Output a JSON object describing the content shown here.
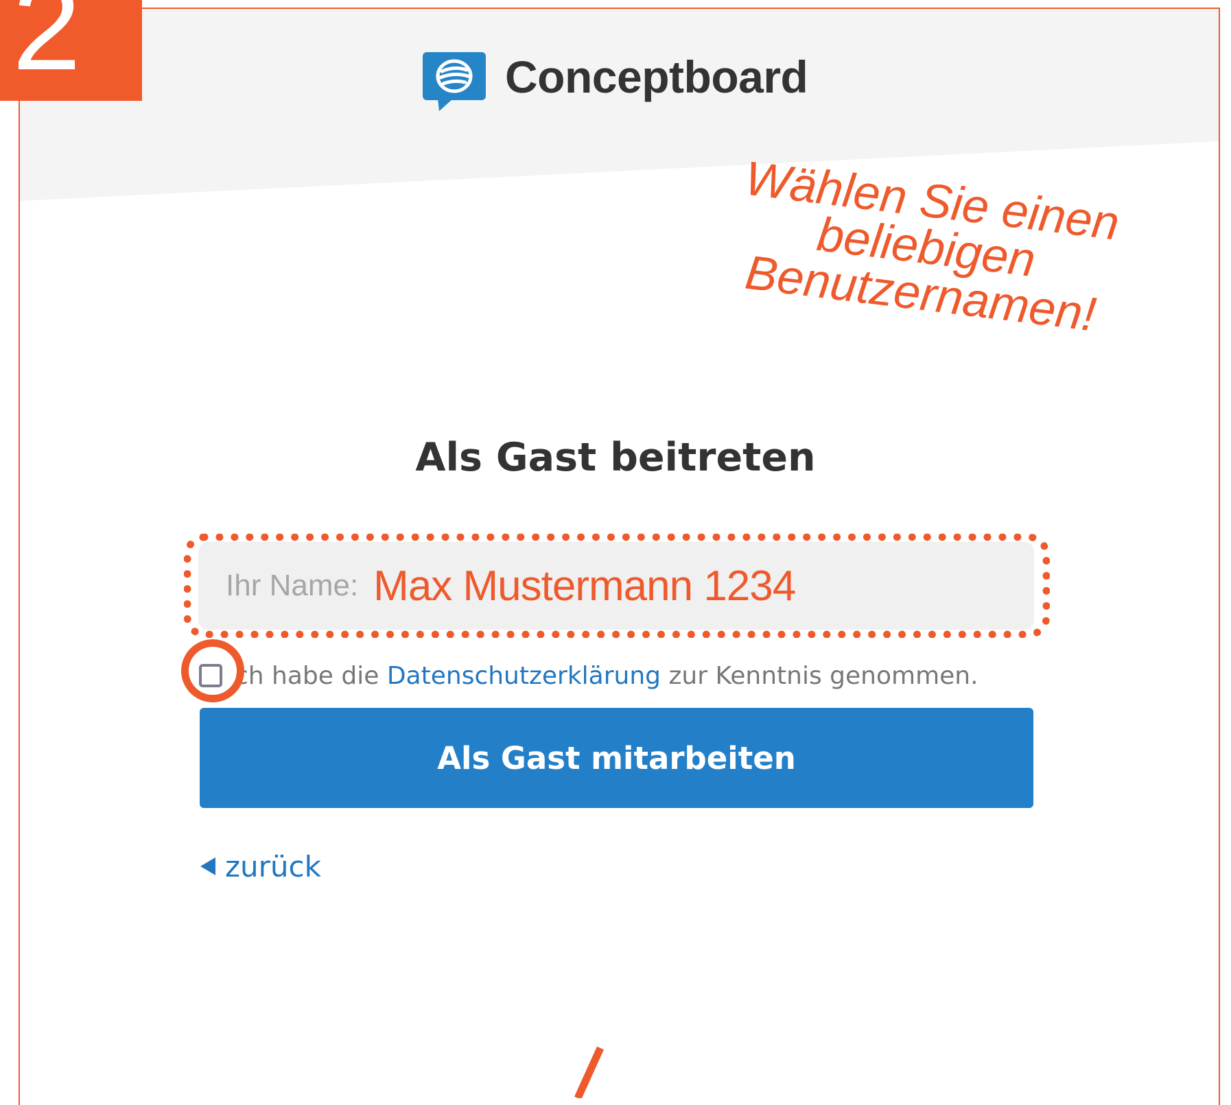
{
  "step": {
    "number": "2"
  },
  "header": {
    "brand": "Conceptboard",
    "brand_color": "#2585C7"
  },
  "annotation": {
    "lines": [
      "Wählen Sie einen",
      "beliebigen",
      "Benutzernamen!"
    ],
    "color": "#EE5A2C"
  },
  "form": {
    "title": "Als Gast beitreten",
    "name_label": "Ihr Name:",
    "name_value": "Max Mustermann 1234",
    "consent": {
      "prefix": "ch habe die",
      "link": "Datenschutzerklärung",
      "suffix": "zur Kenntnis genommen.",
      "checked": false
    },
    "submit_label": "Als Gast mitarbeiten",
    "back_label": "zurück"
  },
  "colors": {
    "accent": "#EE5A2C",
    "primary": "#2380C8",
    "link": "#2277C0"
  },
  "icons": {
    "logo": "speech-bubble-logo-icon",
    "back": "triangle-left-icon"
  }
}
